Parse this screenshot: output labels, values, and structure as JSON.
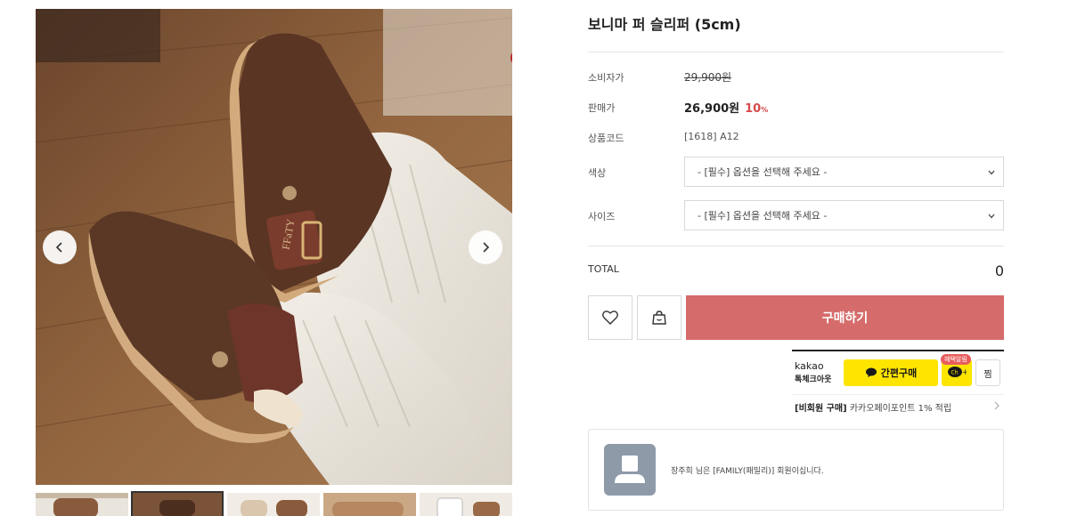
{
  "product": {
    "title": "보니마 퍼 슬리퍼 (5cm)"
  },
  "info": {
    "consumer_price_label": "소비자가",
    "consumer_price": "29,900원",
    "sale_price_label": "판매가",
    "sale_price": "26,900원",
    "discount": "10",
    "discount_unit": "%",
    "code_label": "상품코드",
    "code": "[1618] A12"
  },
  "options": {
    "color_label": "색상",
    "color_placeholder": "- [필수] 옵션을 선택해 주세요 -",
    "size_label": "사이즈",
    "size_placeholder": "- [필수] 옵션을 선택해 주세요 -"
  },
  "total": {
    "label": "TOTAL",
    "value": "0"
  },
  "actions": {
    "buy_label": "구매하기",
    "wishlist_icon": "heart-icon",
    "cart_icon": "shopping-bag-icon"
  },
  "kakao": {
    "brand": "kakao",
    "brand_sub": "톡체크아웃",
    "pay_label": "간편구매",
    "channel_badge": "혜택알림",
    "zzim_label": "찜",
    "promo_bold": "[비회원 구매]",
    "promo_text": "카카오페이포인트 1% 적립",
    "accent": "#fee500"
  },
  "member": {
    "message": "장주희 님은 [FAMILY(패밀리)] 회원이십니다."
  },
  "gallery": {
    "image_text": "FFaTY",
    "thumbnail_count": 5,
    "active_thumbnail": 2
  },
  "colors": {
    "buy_button": "#d66b6b",
    "discount": "#d64a4a"
  }
}
